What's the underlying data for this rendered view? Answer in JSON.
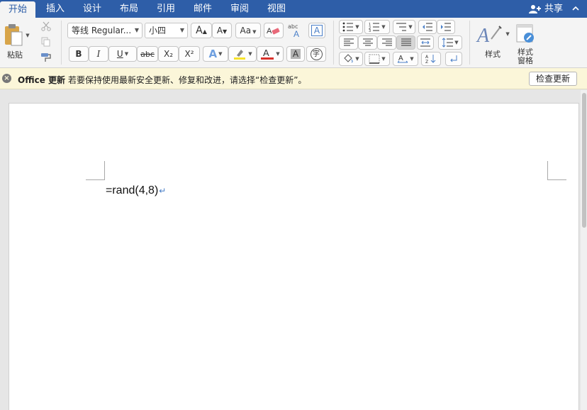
{
  "tabs": [
    {
      "label": "开始",
      "active": true
    },
    {
      "label": "插入",
      "active": false
    },
    {
      "label": "设计",
      "active": false
    },
    {
      "label": "布局",
      "active": false
    },
    {
      "label": "引用",
      "active": false
    },
    {
      "label": "邮件",
      "active": false
    },
    {
      "label": "审阅",
      "active": false
    },
    {
      "label": "视图",
      "active": false
    }
  ],
  "share_label": "共享",
  "ribbon": {
    "paste_label": "粘贴",
    "font_name": "等线 Regular...",
    "font_size": "小四",
    "bold": "B",
    "italic": "I",
    "underline": "U",
    "strikethrough": "abc",
    "subscript": "X₂",
    "superscript": "X²",
    "styles_label": "样式",
    "styles_pane_label_line1": "样式",
    "styles_pane_label_line2": "窗格"
  },
  "update_bar": {
    "title": "Office 更新",
    "message": "若要保持使用最新安全更新、修复和改进，请选择“检查更新”。",
    "button": "检查更新"
  },
  "document": {
    "text": "=rand(4,8)",
    "paragraph_mark": "↵"
  },
  "colors": {
    "tab_bar": "#2e5ea8",
    "highlight": "#f7e32b",
    "font_color": "#d9312b"
  }
}
